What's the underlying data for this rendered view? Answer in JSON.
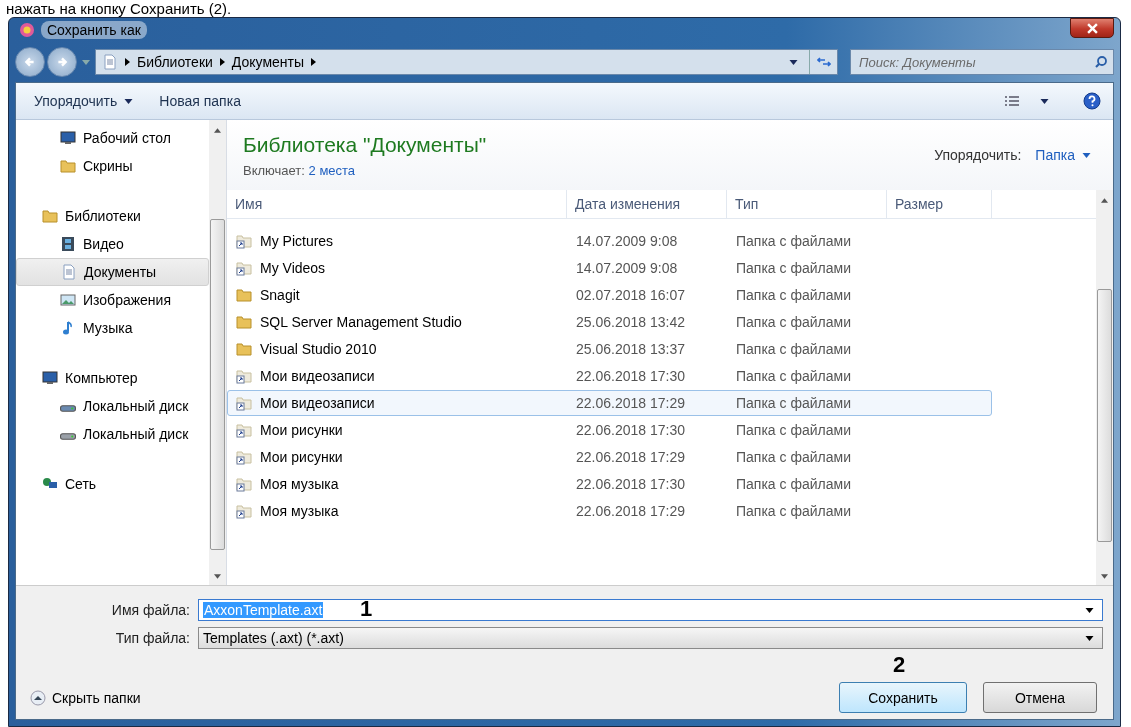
{
  "caption": "нажать на кнопку Сохранить (2).",
  "window": {
    "title": "Сохранить как"
  },
  "address": {
    "crumbs": [
      "Библиотеки",
      "Документы"
    ]
  },
  "search": {
    "placeholder": "Поиск: Документы"
  },
  "toolbar": {
    "organize": "Упорядочить",
    "new_folder": "Новая папка"
  },
  "sidebar": {
    "sections": [
      {
        "children": [
          {
            "label": "Рабочий стол",
            "kind": "desktop",
            "selected": false
          },
          {
            "label": "Скрины",
            "kind": "folder",
            "selected": false
          }
        ]
      },
      {
        "label": "Библиотеки",
        "kind": "library",
        "children": [
          {
            "label": "Видео",
            "kind": "video",
            "selected": false
          },
          {
            "label": "Документы",
            "kind": "document",
            "selected": true
          },
          {
            "label": "Изображения",
            "kind": "pictures",
            "selected": false
          },
          {
            "label": "Музыка",
            "kind": "music",
            "selected": false
          }
        ]
      },
      {
        "label": "Компьютер",
        "kind": "computer",
        "children": [
          {
            "label": "Локальный диск",
            "kind": "system-disk",
            "selected": false
          },
          {
            "label": "Локальный диск",
            "kind": "disk",
            "selected": false
          }
        ]
      },
      {
        "label": "Сеть",
        "kind": "network"
      }
    ]
  },
  "library": {
    "title": "Библиотека \"Документы\"",
    "includes_label": "Включает:",
    "includes_link": "2 места",
    "arrange_label": "Упорядочить:",
    "arrange_value": "Папка"
  },
  "table": {
    "columns": [
      "Имя",
      "Дата изменения",
      "Тип",
      "Размер"
    ],
    "rows": [
      {
        "name": "My Pictures",
        "date": "14.07.2009 9:08",
        "type": "Папка с файлами",
        "kind": "shortcut",
        "selected": false
      },
      {
        "name": "My Videos",
        "date": "14.07.2009 9:08",
        "type": "Папка с файлами",
        "kind": "shortcut",
        "selected": false
      },
      {
        "name": "Snagit",
        "date": "02.07.2018 16:07",
        "type": "Папка с файлами",
        "kind": "folder",
        "selected": false
      },
      {
        "name": "SQL Server Management Studio",
        "date": "25.06.2018 13:42",
        "type": "Папка с файлами",
        "kind": "folder",
        "selected": false
      },
      {
        "name": "Visual Studio 2010",
        "date": "25.06.2018 13:37",
        "type": "Папка с файлами",
        "kind": "folder",
        "selected": false
      },
      {
        "name": "Мои видеозаписи",
        "date": "22.06.2018 17:30",
        "type": "Папка с файлами",
        "kind": "shortcut",
        "selected": false
      },
      {
        "name": "Мои видеозаписи",
        "date": "22.06.2018 17:29",
        "type": "Папка с файлами",
        "kind": "shortcut",
        "selected": true
      },
      {
        "name": "Мои рисунки",
        "date": "22.06.2018 17:30",
        "type": "Папка с файлами",
        "kind": "shortcut",
        "selected": false
      },
      {
        "name": "Мои рисунки",
        "date": "22.06.2018 17:29",
        "type": "Папка с файлами",
        "kind": "shortcut",
        "selected": false
      },
      {
        "name": "Моя музыка",
        "date": "22.06.2018 17:30",
        "type": "Папка с файлами",
        "kind": "shortcut",
        "selected": false
      },
      {
        "name": "Моя музыка",
        "date": "22.06.2018 17:29",
        "type": "Папка с файлами",
        "kind": "shortcut",
        "selected": false
      }
    ]
  },
  "filename": {
    "label": "Имя файла:",
    "value": "AxxonTemplate.axt",
    "selected": true
  },
  "filetype": {
    "label": "Тип файла:",
    "value": "Templates (.axt) (*.axt)"
  },
  "hide_folders": "Скрыть папки",
  "buttons": {
    "save": "Сохранить",
    "cancel": "Отмена"
  },
  "annotations": [
    {
      "label": "1"
    },
    {
      "label": "2"
    }
  ]
}
